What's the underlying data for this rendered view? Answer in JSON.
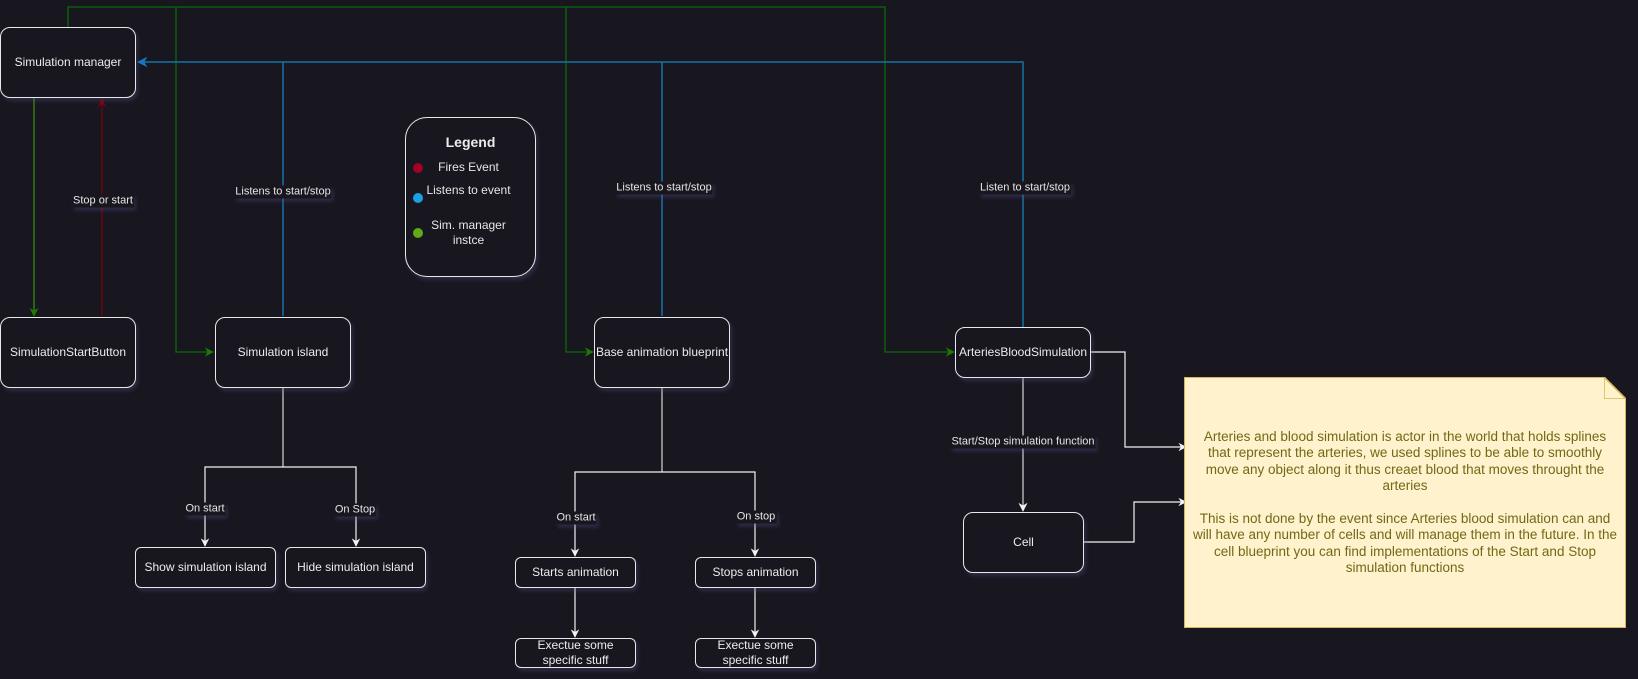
{
  "colors": {
    "background": "#18161f",
    "fires_event": "#a20025",
    "listens_event": "#1ba1e2",
    "sim_manager_instance": "#60a917",
    "green_edge": "#005700",
    "blue_edge": "#006eaf",
    "red_edge": "#6f0000",
    "note_fill": "#fff2cc",
    "note_stroke": "#d6b656",
    "note_text": "#6f6a16"
  },
  "nodes": {
    "simulation_manager": "Simulation manager",
    "simulation_start_button": "SimulationStartButton",
    "simulation_island": "Simulation island",
    "base_animation_blueprint": "Base animation blueprint",
    "arteries_blood_simulation": "ArteriesBloodSimulation",
    "cell": "Cell",
    "show_simulation_island": "Show simulation island",
    "hide_simulation_island": "Hide simulation island",
    "starts_animation": "Starts animation",
    "stops_animation": "Stops animation",
    "execute_start": "Exectue some specific stuff",
    "execute_stop": "Exectue some specific stuff"
  },
  "edge_labels": {
    "stop_or_start": "Stop or start",
    "island_listens": "Listens to start/stop",
    "blueprint_listens": "Listens to start/stop",
    "arteries_listen": "Listen to start/stop",
    "island_on_start": "On start",
    "island_on_stop": "On Stop",
    "anim_on_start": "On start",
    "anim_on_stop": "On stop",
    "start_stop_function": "Start/Stop simulation function"
  },
  "legend": {
    "title": "Legend",
    "items": [
      {
        "label": "Fires Event",
        "color": "#a20025"
      },
      {
        "label": "Listens to event",
        "color": "#1ba1e2"
      },
      {
        "label": "Sim. manager instce",
        "color": "#60a917"
      }
    ]
  },
  "note": {
    "paragraph1": "Arteries and blood simulation is actor in the world that holds splines that represent the arteries, we used splines to be able to smoothly move any object along it thus creaet blood that moves throught the arteries",
    "paragraph2": "This is not done by the event since Arteries blood simulation can and will have any number of cells and will manage them in the future. In the cell blueprint you can find implementations of the Start and Stop simulation functions"
  }
}
